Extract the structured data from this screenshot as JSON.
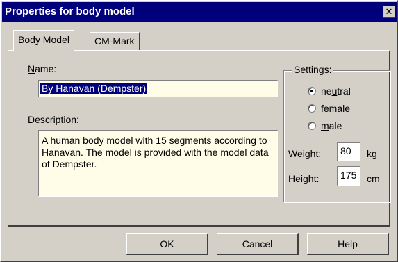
{
  "window": {
    "title": "Properties for body model",
    "close_glyph": "✕"
  },
  "tabs": [
    {
      "label": "Body Model",
      "active": true
    },
    {
      "label": "CM-Mark",
      "active": false
    }
  ],
  "body_model": {
    "name_label_hotkey": "N",
    "name_label_rest": "ame:",
    "name_value": "By Hanavan (Dempster)",
    "description_label_hotkey": "D",
    "description_label_rest": "escription:",
    "description_value": "A human body model with 15 segments according to Hanavan. The model is provided with the model data of Dempster."
  },
  "settings": {
    "legend": "Settings:",
    "gender_options": [
      {
        "pre": "ne",
        "hotkey": "u",
        "post": "tral",
        "checked": true
      },
      {
        "pre": "",
        "hotkey": "f",
        "post": "emale",
        "checked": false
      },
      {
        "pre": "",
        "hotkey": "m",
        "post": "ale",
        "checked": false
      }
    ],
    "weight_label_hotkey": "W",
    "weight_label_rest": "eight:",
    "weight_value": "80",
    "weight_unit": "kg",
    "height_label_hotkey": "H",
    "height_label_rest": "eight:",
    "height_value": "175",
    "height_unit": "cm"
  },
  "buttons": {
    "ok": "OK",
    "cancel": "Cancel",
    "help": "Help"
  }
}
